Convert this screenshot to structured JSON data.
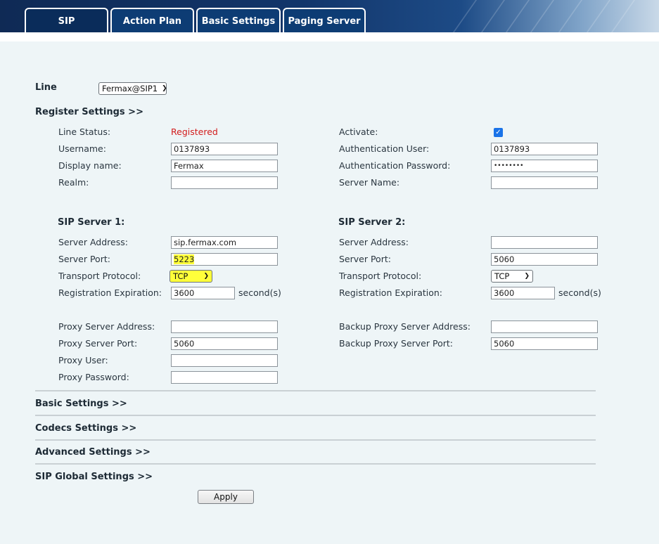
{
  "tabs": [
    "SIP",
    "Action Plan",
    "Basic Settings",
    "Paging Server"
  ],
  "line": {
    "label": "Line",
    "selected": "Fermax@SIP1"
  },
  "register_settings": {
    "title": "Register Settings >>",
    "line_status_label": "Line Status:",
    "line_status_value": "Registered",
    "username_label": "Username:",
    "username_value": "0137893",
    "display_name_label": "Display name:",
    "display_name_value": "Fermax",
    "realm_label": "Realm:",
    "realm_value": "",
    "activate_label": "Activate:",
    "activate_checked": true,
    "auth_user_label": "Authentication User:",
    "auth_user_value": "0137893",
    "auth_password_label": "Authentication Password:",
    "auth_password_value": "••••••••",
    "server_name_label": "Server Name:",
    "server_name_value": ""
  },
  "sip_server_1": {
    "title": "SIP Server 1:",
    "address_label": "Server Address:",
    "address_value": "sip.fermax.com",
    "port_label": "Server Port:",
    "port_value": "5223",
    "transport_label": "Transport Protocol:",
    "transport_value": "TCP",
    "expiration_label": "Registration Expiration:",
    "expiration_value": "3600",
    "expiration_unit": "second(s)"
  },
  "sip_server_2": {
    "title": "SIP Server 2:",
    "address_label": "Server Address:",
    "address_value": "",
    "port_label": "Server Port:",
    "port_value": "5060",
    "transport_label": "Transport Protocol:",
    "transport_value": "TCP",
    "expiration_label": "Registration Expiration:",
    "expiration_value": "3600",
    "expiration_unit": "second(s)"
  },
  "proxy": {
    "address_label": "Proxy Server Address:",
    "address_value": "",
    "port_label": "Proxy Server Port:",
    "port_value": "5060",
    "user_label": "Proxy User:",
    "user_value": "",
    "password_label": "Proxy Password:",
    "password_value": "",
    "backup_address_label": "Backup Proxy Server Address:",
    "backup_address_value": "",
    "backup_port_label": "Backup Proxy Server Port:",
    "backup_port_value": "5060"
  },
  "sections": {
    "basic": "Basic Settings >>",
    "codecs": "Codecs Settings >>",
    "advanced": "Advanced Settings >>",
    "sip_global": "SIP Global Settings >>"
  },
  "apply_label": "Apply",
  "colors": {
    "registered": "#d21c1c",
    "highlight": "#ffff3a",
    "tab_bg": "#0d3c74",
    "page_bg": "#eef5f7"
  }
}
